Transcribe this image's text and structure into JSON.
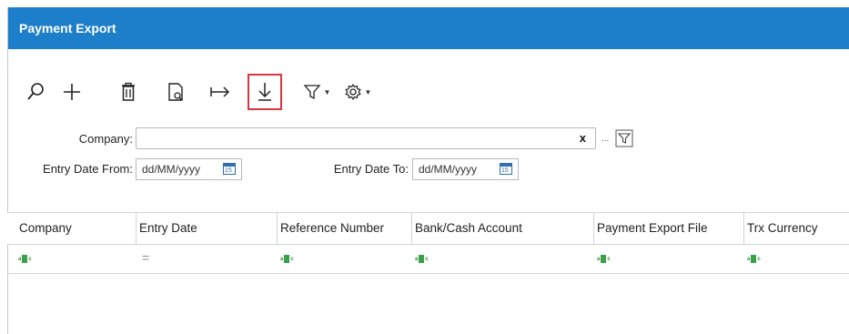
{
  "window": {
    "title": "Payment Export"
  },
  "toolbar": {
    "icons": [
      "search-icon",
      "add-icon",
      "delete-icon",
      "preview-icon",
      "export-arrow-icon",
      "download-icon",
      "filter-icon",
      "settings-icon"
    ]
  },
  "form": {
    "company_label": "Company:",
    "company_value": "",
    "clear_label": "x",
    "lookup_label": "...",
    "entry_date_from_label": "Entry Date From:",
    "entry_date_from_placeholder": "dd/MM/yyyy",
    "entry_date_to_label": "Entry Date To:",
    "entry_date_to_placeholder": "dd/MM/yyyy",
    "calendar_day": "15"
  },
  "grid": {
    "columns": [
      "Company",
      "Entry Date",
      "Reference Number",
      "Bank/Cash Account",
      "Payment Export File",
      "Trx Currency"
    ],
    "filter_abc_left": "a",
    "filter_abc_right": "c",
    "filter_equals": "="
  },
  "colors": {
    "titlebar": "#1d7fc9",
    "highlight": "#d9363e",
    "text_filter": "#3aa14a"
  }
}
